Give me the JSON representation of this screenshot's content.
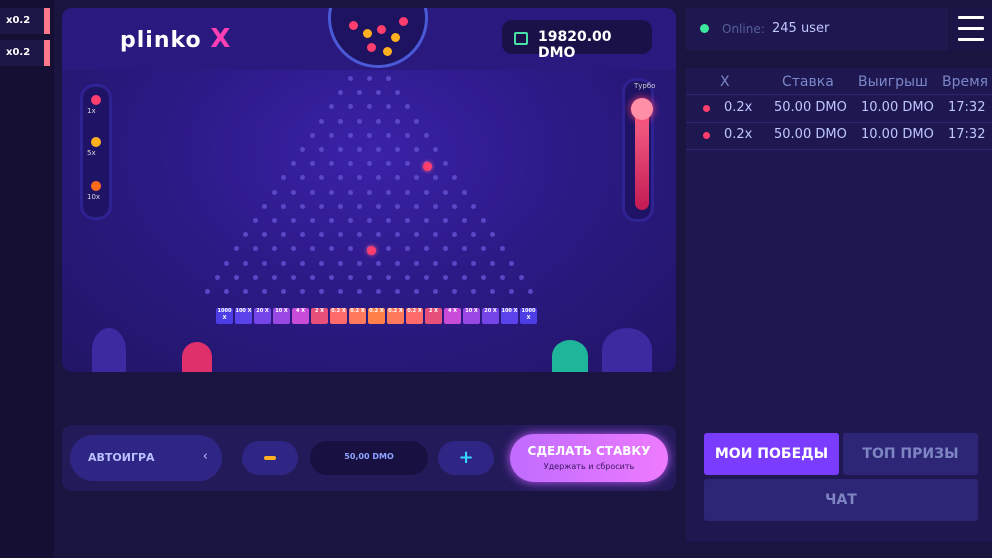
{
  "history": [
    {
      "label": "x0.2",
      "color": "#ff7a8a"
    },
    {
      "label": "x0.2",
      "color": "#ff7a8a"
    }
  ],
  "board": {
    "logo": "plinko",
    "logo_x": "X",
    "balance": "19820.00 DMO",
    "balance_icon": "wallet-icon",
    "risk_gauge": [
      "1x",
      "5x",
      "10x"
    ],
    "turbo_label": "Турбо",
    "slots": [
      "1000 X",
      "100 X",
      "20 X",
      "10 X",
      "4 X",
      "2 X",
      "0.2 X",
      "0.2 X",
      "0.2 X",
      "0.2 X",
      "0.2 X",
      "2 X",
      "4 X",
      "10 X",
      "20 X",
      "100 X",
      "1000 X"
    ]
  },
  "controls": {
    "autoplay": "АВТОИГРА",
    "amount": "50,00 DMO",
    "plus": "+",
    "bet_main": "СДЕЛАТЬ СТАВКУ",
    "bet_sub": "Удержать и сбросить"
  },
  "online": {
    "label": "Online:",
    "value": "245 user"
  },
  "table": {
    "headers": [
      "X",
      "Ставка",
      "Выигрыш",
      "Время"
    ],
    "rows": [
      {
        "x": "0.2x",
        "bet": "50.00 DMO",
        "win": "10.00 DMO",
        "time": "17:32"
      },
      {
        "x": "0.2x",
        "bet": "50.00 DMO",
        "win": "10.00 DMO",
        "time": "17:32"
      }
    ]
  },
  "tabs": {
    "wins": "МОИ ПОБЕДЫ",
    "top": "ТОП ПРИЗЫ",
    "chat": "ЧАТ"
  }
}
